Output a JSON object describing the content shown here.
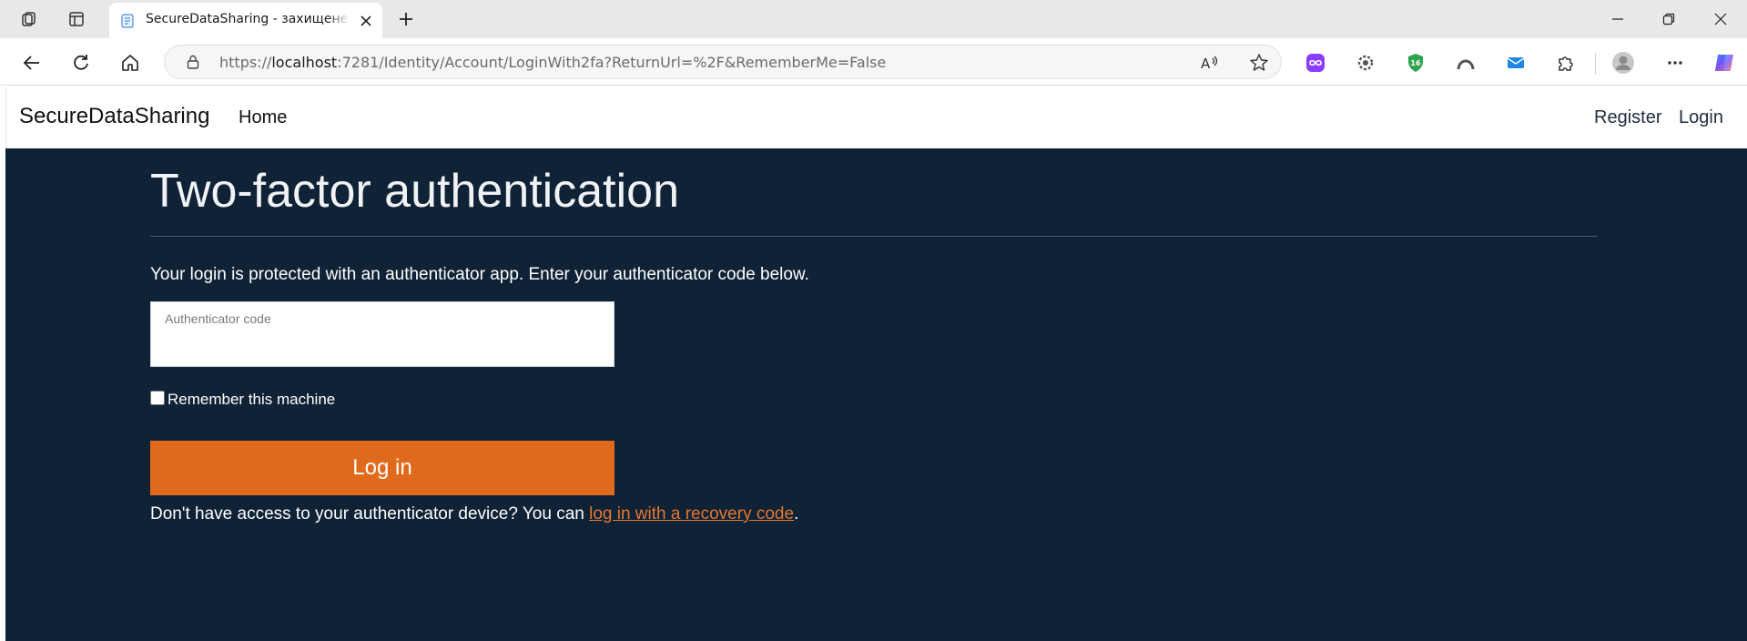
{
  "browser": {
    "tab": {
      "title": "SecureDataSharing - захищене сховище",
      "favicon": "page-icon"
    },
    "address_bar": {
      "scheme": "https://",
      "host": "localhost",
      "path": ":7281/Identity/Account/LoginWith2fa?ReturnUrl=%2F&RememberMe=False"
    },
    "extensions": [
      {
        "name": "infinity-extension-icon",
        "color": "#8b3dff"
      },
      {
        "name": "gear-extension-icon",
        "color": "#5a5a5a"
      },
      {
        "name": "shield-extension-icon",
        "color": "#2ea44f",
        "badge": "16"
      },
      {
        "name": "arc-extension-icon",
        "color": "#5a5a5a"
      },
      {
        "name": "mail-extension-icon",
        "color": "#1e88e5"
      },
      {
        "name": "puzzle-extensions-icon",
        "color": "#333333"
      },
      {
        "name": "profile-avatar-icon",
        "color": "#b0b0b0"
      },
      {
        "name": "more-icon",
        "color": "#333333"
      },
      {
        "name": "copilot-icon",
        "color": "#3b82f6"
      }
    ]
  },
  "site": {
    "brand": "SecureDataSharing",
    "nav": {
      "home": "Home",
      "register": "Register",
      "login": "Login"
    }
  },
  "page": {
    "title": "Two-factor authentication",
    "intro": "Your login is protected with an authenticator app. Enter your authenticator code below.",
    "code_field": {
      "label": "Authenticator code",
      "value": ""
    },
    "remember_label": "Remember this machine",
    "remember_checked": false,
    "login_button": "Log in",
    "recovery": {
      "prefix": "Don't have access to your authenticator device? You can ",
      "link": "log in with a recovery code",
      "suffix": "."
    }
  },
  "colors": {
    "main_bg": "#0f2236",
    "accent": "#e06a1b",
    "link": "#e5772e"
  }
}
